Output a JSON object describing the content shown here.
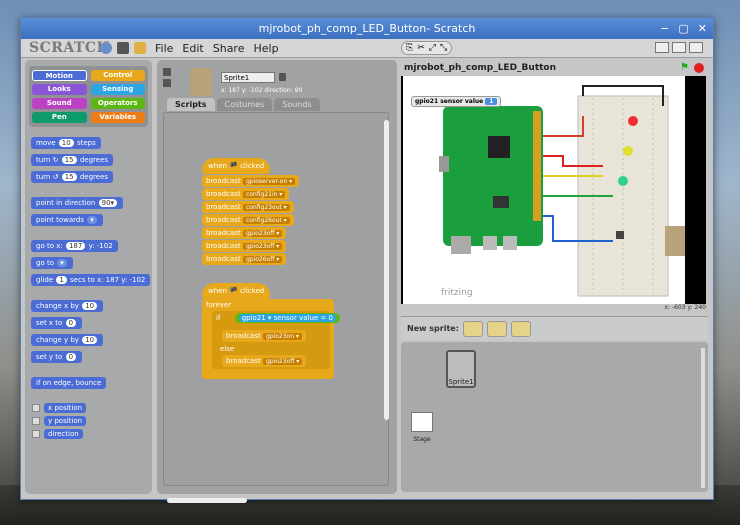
{
  "window": {
    "title": "mjrobot_ph_comp_LED_Button- Scratch",
    "controls": [
      "−",
      "▢",
      "✕"
    ]
  },
  "menubar": {
    "logo": "SCRATCH",
    "items": [
      "File",
      "Edit",
      "Share",
      "Help"
    ]
  },
  "palette": {
    "categories": [
      {
        "label": "Motion",
        "color": "#4a6cd4"
      },
      {
        "label": "Control",
        "color": "#e7a81b"
      },
      {
        "label": "Looks",
        "color": "#8a55d7"
      },
      {
        "label": "Sensing",
        "color": "#2ca5e2"
      },
      {
        "label": "Sound",
        "color": "#bb42c3"
      },
      {
        "label": "Operators",
        "color": "#5cb712"
      },
      {
        "label": "Pen",
        "color": "#0e9a6c"
      },
      {
        "label": "Variables",
        "color": "#ee7d16"
      }
    ],
    "blocks": [
      {
        "pre": "move",
        "in1": "10",
        "post": "steps"
      },
      {
        "pre": "turn ↻",
        "in1": "15",
        "post": "degrees"
      },
      {
        "pre": "turn ↺",
        "in1": "15",
        "post": "degrees"
      },
      {
        "pre": "point in direction",
        "in1": "90▾",
        "post": ""
      },
      {
        "pre": "point towards",
        "in1": "▾",
        "post": ""
      },
      {
        "pre": "go to x:",
        "in1": "187",
        "post": "y: -102"
      },
      {
        "pre": "go to",
        "in1": "▾",
        "post": ""
      },
      {
        "pre": "glide",
        "in1": "1",
        "post": "secs to x: 187 y: -102"
      },
      {
        "pre": "change x by",
        "in1": "10",
        "post": ""
      },
      {
        "pre": "set x to",
        "in1": "0",
        "post": ""
      },
      {
        "pre": "change y by",
        "in1": "10",
        "post": ""
      },
      {
        "pre": "set y to",
        "in1": "0",
        "post": ""
      },
      {
        "pre": "if on edge, bounce",
        "in1": "",
        "post": ""
      }
    ],
    "reporters": [
      "x position",
      "y position",
      "direction"
    ]
  },
  "sprite": {
    "name": "Sprite1",
    "coords": "x: 187  y: -102  direction: 90",
    "tabs": [
      "Scripts",
      "Costumes",
      "Sounds"
    ]
  },
  "script1": {
    "hat": "when 🏴 clicked",
    "blocks": [
      {
        "label": "broadcast",
        "value": "gpioserver-on ▾"
      },
      {
        "label": "broadcast",
        "value": "config21in ▾"
      },
      {
        "label": "broadcast",
        "value": "config23out ▾"
      },
      {
        "label": "broadcast",
        "value": "config26out ▾"
      },
      {
        "label": "broadcast",
        "value": "gpio23off ▾"
      },
      {
        "label": "broadcast",
        "value": "gpio23off ▾"
      },
      {
        "label": "broadcast",
        "value": "gpio26off ▾"
      }
    ]
  },
  "script2": {
    "hat": "when 🏴 clicked",
    "forever": "forever",
    "if": "if",
    "condition": "gpio21 ▾ sensor value = 0",
    "then": {
      "label": "broadcast",
      "value": "gpio23on ▾"
    },
    "else": "else",
    "else_block": {
      "label": "broadcast",
      "value": "gpio23off ▾"
    }
  },
  "stage": {
    "title": "mjrobot_ph_comp_LED_Button",
    "monitor_label": "gpio21 sensor value",
    "monitor_value": "1",
    "watermark": "fritzing",
    "xy": "x: -603   y: 240"
  },
  "newsprite": {
    "label": "New sprite:"
  },
  "sprites": [
    {
      "label": "Sprite1"
    }
  ],
  "stage_thumb": {
    "label": "Stage"
  },
  "colors": {
    "motion": "#4a6cd4",
    "control": "#e7a81b",
    "sensing": "#2ca5e2",
    "operators": "#5cb712"
  }
}
